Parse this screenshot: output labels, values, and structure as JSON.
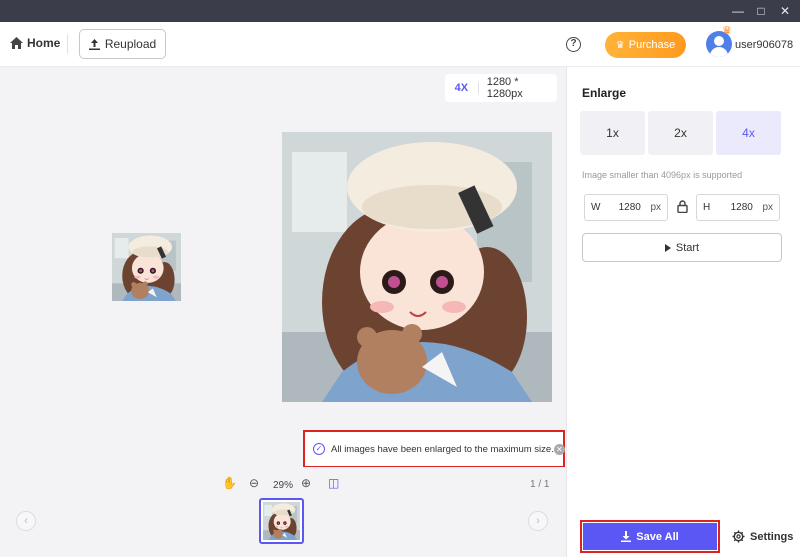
{
  "window": {
    "controls": [
      "minimize",
      "maximize",
      "close"
    ]
  },
  "header": {
    "home_label": "Home",
    "reupload_label": "Reupload",
    "help_label": "?",
    "purchase_label": "Purchase",
    "username": "user906078"
  },
  "canvas": {
    "scale_badge": "4X",
    "output_size": "1280 * 1280px",
    "toast_message": "All images have been enlarged to the maximum size."
  },
  "strip": {
    "zoom_level": "29%",
    "page_counter": "1 / 1"
  },
  "panel": {
    "title": "Enlarge",
    "scales": [
      {
        "label": "1x",
        "active": false
      },
      {
        "label": "2x",
        "active": false
      },
      {
        "label": "4x",
        "active": true
      }
    ],
    "note": "Image smaller than 4096px is supported",
    "width_label": "W",
    "width_value": "1280",
    "height_label": "H",
    "height_value": "1280",
    "unit": "px",
    "start_label": "Start",
    "save_all_label": "Save All",
    "settings_label": "Settings"
  },
  "colors": {
    "accent": "#5b57f4",
    "purchase": "#ff9a1f",
    "highlight": "#dd2222"
  }
}
